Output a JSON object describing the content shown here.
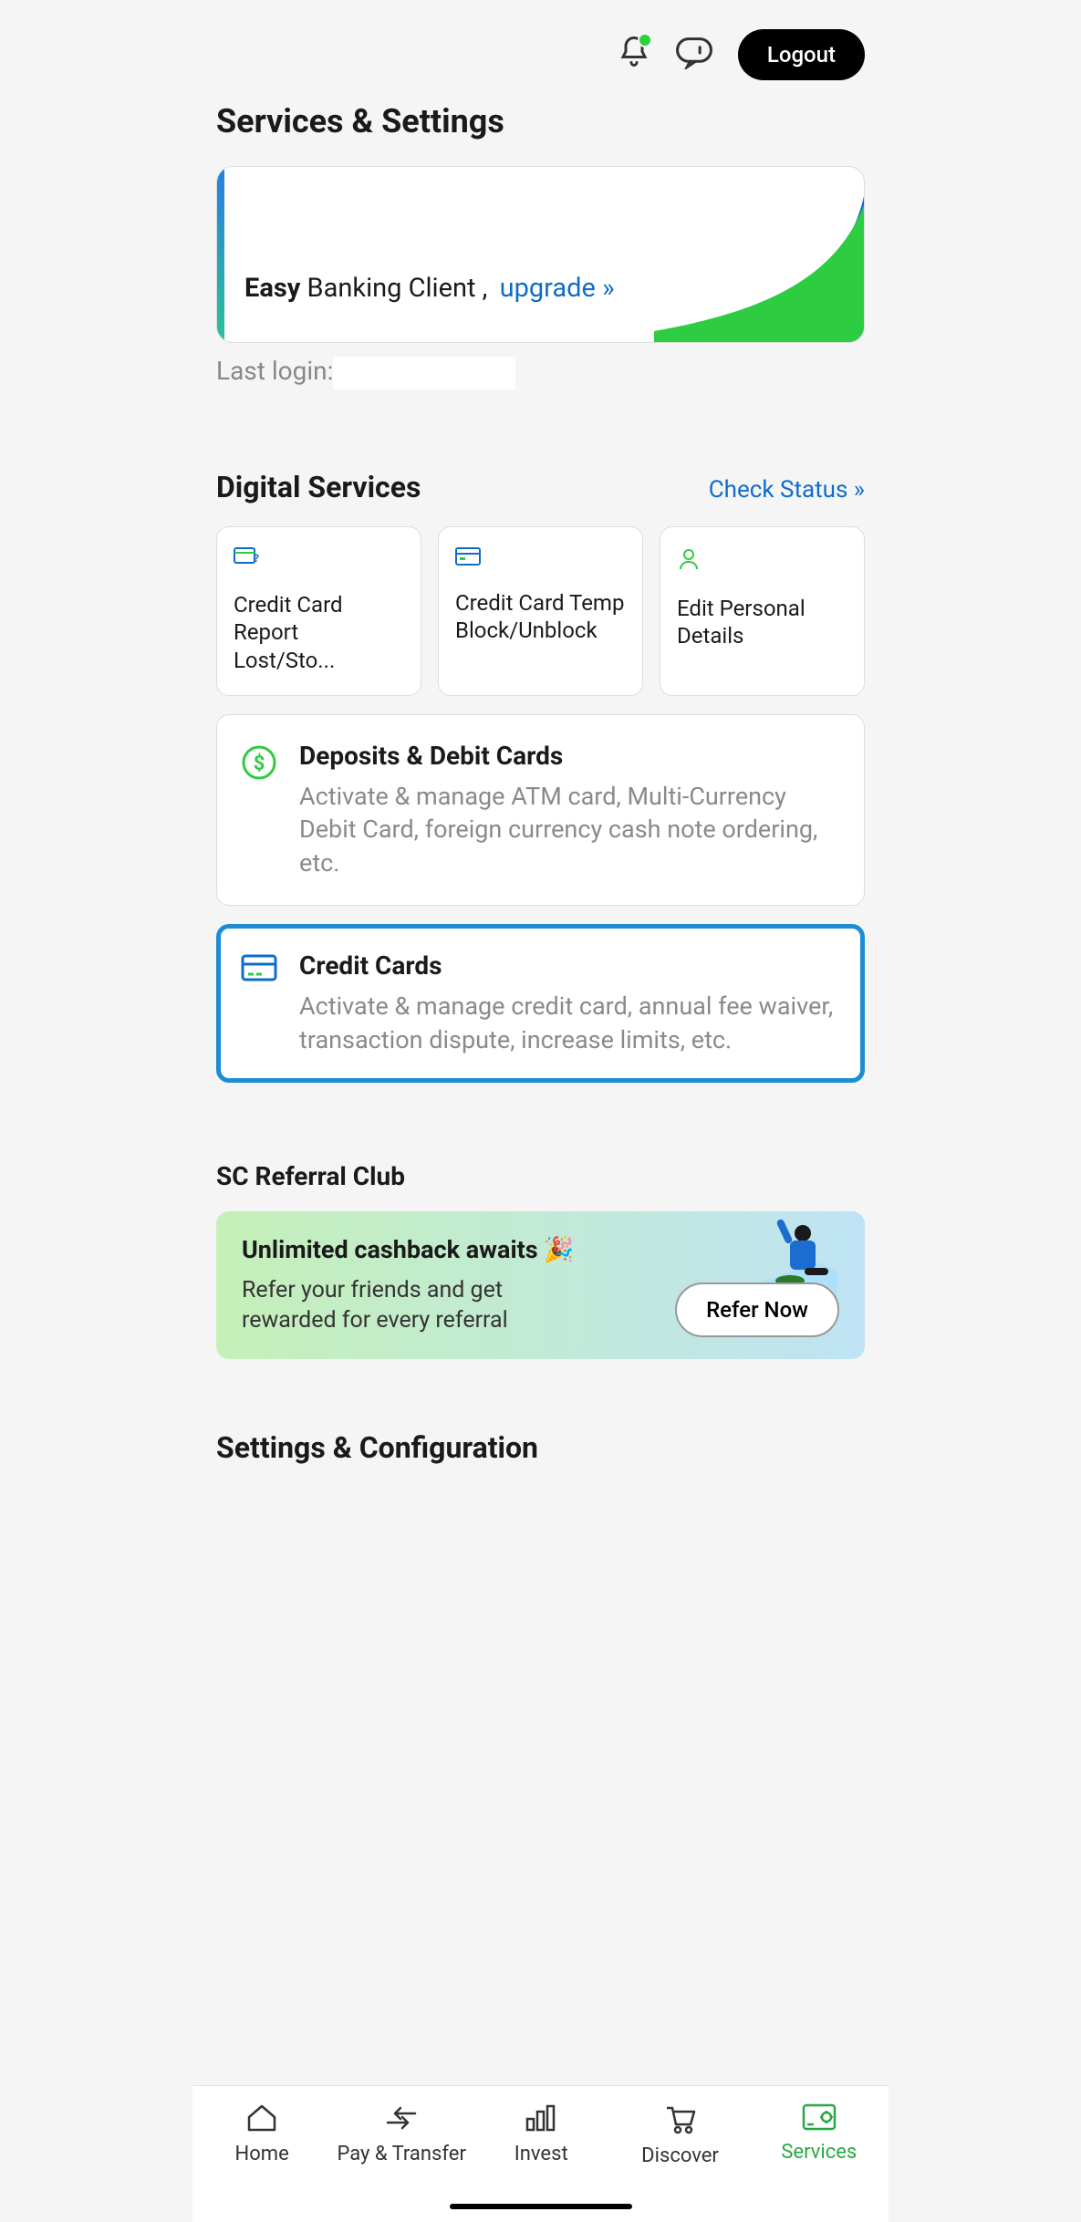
{
  "header": {
    "logout_label": "Logout"
  },
  "page_title": "Services & Settings",
  "hero": {
    "bold_text": "Easy",
    "normal_text": " Banking Client ,",
    "link_text": "upgrade »"
  },
  "last_login_label": "Last login:",
  "digital_services": {
    "title": "Digital Services",
    "status_link": "Check Status  »",
    "tiles": [
      {
        "label": "Credit Card Report Lost/Sto..."
      },
      {
        "label": "Credit Card Temp Block/Unblock"
      },
      {
        "label": "Edit Personal Details"
      }
    ]
  },
  "big_cards": [
    {
      "title": "Deposits & Debit Cards",
      "desc": "Activate & manage ATM card, Multi-Currency Debit Card, foreign currency cash note ordering, etc.",
      "active": false
    },
    {
      "title": "Credit Cards",
      "desc": "Activate & manage credit card, annual fee waiver, transaction dispute, increase limits, etc.",
      "active": true
    }
  ],
  "referral": {
    "section_title": "SC Referral Club",
    "banner_title": "Unlimited cashback awaits",
    "emoji": "🎉",
    "subtitle": "Refer your friends and get rewarded for every referral",
    "button": "Refer Now"
  },
  "settings_title": "Settings & Configuration",
  "nav": [
    {
      "label": "Home",
      "icon": "home-icon"
    },
    {
      "label": "Pay & Transfer",
      "icon": "transfer-icon"
    },
    {
      "label": "Invest",
      "icon": "chart-icon"
    },
    {
      "label": "Discover",
      "icon": "cart-icon"
    },
    {
      "label": "Services",
      "icon": "services-icon",
      "active": true
    }
  ]
}
